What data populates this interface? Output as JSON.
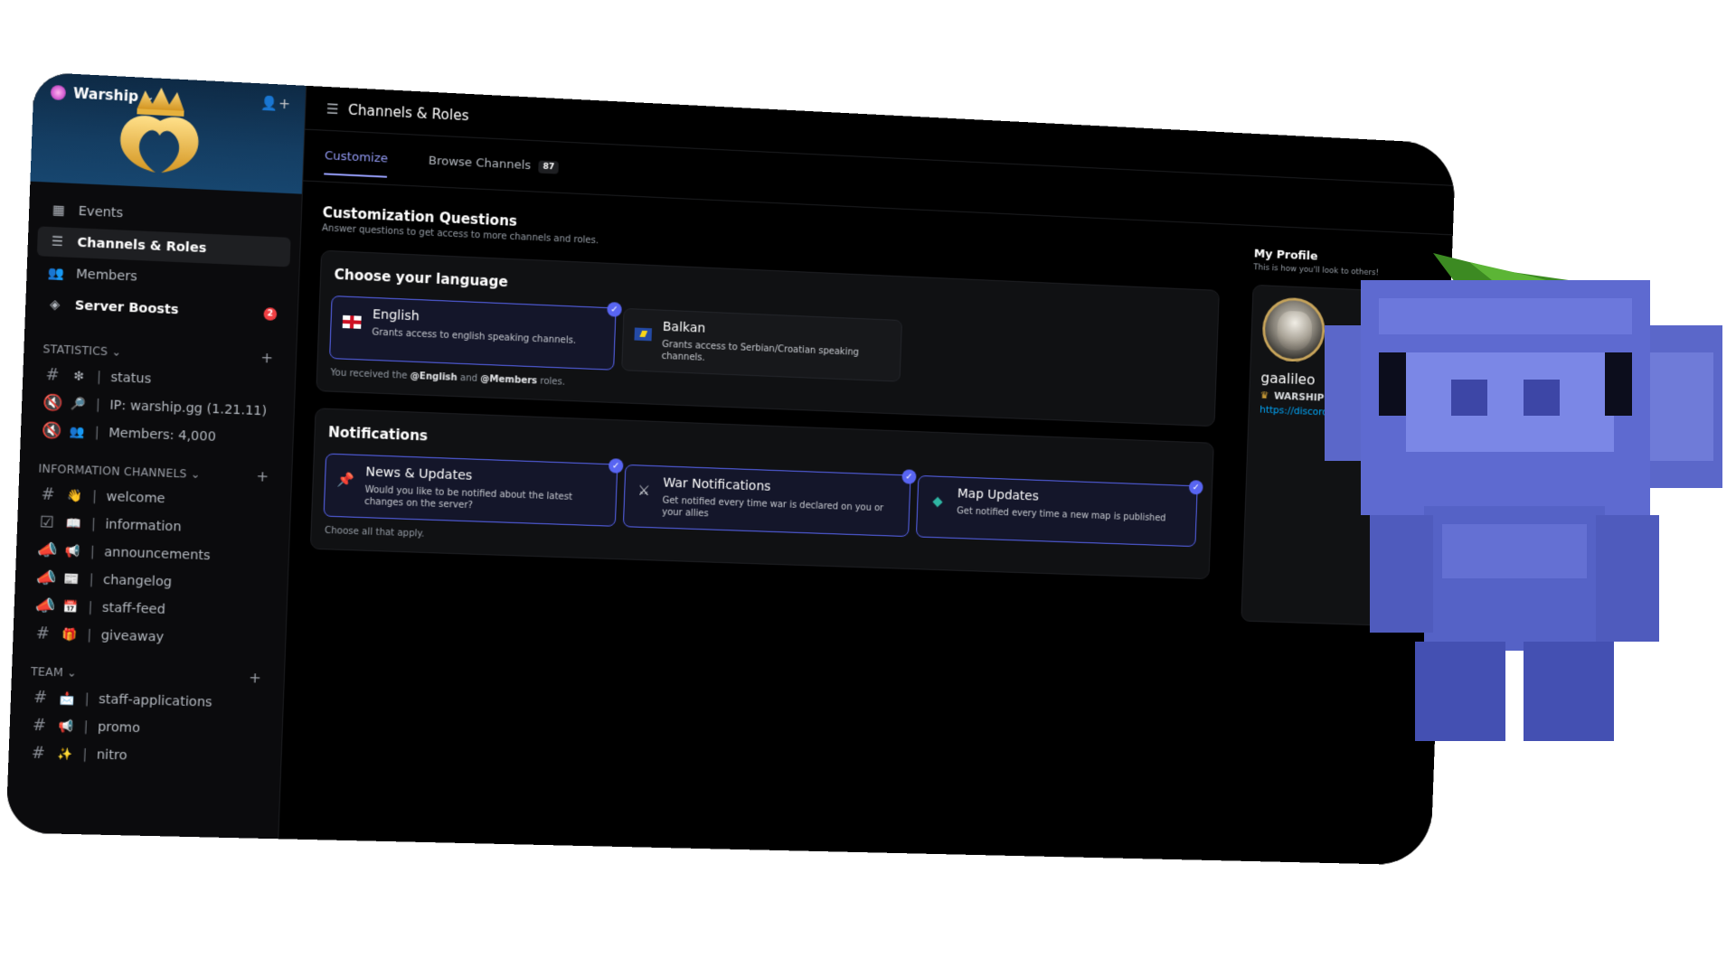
{
  "server": {
    "name": "Warship"
  },
  "nav": [
    {
      "label": "Events",
      "icon": "calendar-icon"
    },
    {
      "label": "Channels & Roles",
      "icon": "channels-roles-icon",
      "active": true
    },
    {
      "label": "Members",
      "icon": "members-icon"
    },
    {
      "label": "Server Boosts",
      "icon": "boost-icon",
      "badge": "2"
    }
  ],
  "categories": [
    {
      "name": "STATISTICS",
      "channels": [
        {
          "icon": "hash-icon",
          "emoji": "❇",
          "name": "status"
        },
        {
          "icon": "speaker-muted-icon",
          "emoji": "🔎",
          "name": "IP: warship.gg (1.21.11)"
        },
        {
          "icon": "speaker-muted-icon",
          "emoji": "👥",
          "name": "Members: 4,000"
        }
      ]
    },
    {
      "name": "INFORMATION CHANNELS",
      "channels": [
        {
          "icon": "hash-icon",
          "emoji": "👋",
          "name": "welcome"
        },
        {
          "icon": "rules-icon",
          "emoji": "📖",
          "name": "information"
        },
        {
          "icon": "megaphone-icon",
          "emoji": "📢",
          "name": "announcements"
        },
        {
          "icon": "megaphone-icon",
          "emoji": "📰",
          "name": "changelog"
        },
        {
          "icon": "megaphone-icon",
          "emoji": "📅",
          "name": "staff-feed"
        },
        {
          "icon": "hash-icon",
          "emoji": "🎁",
          "name": "giveaway"
        }
      ]
    },
    {
      "name": "TEAM",
      "channels": [
        {
          "icon": "hash-icon",
          "emoji": "📩",
          "name": "staff-applications"
        },
        {
          "icon": "hash-icon",
          "emoji": "📢",
          "name": "promo"
        },
        {
          "icon": "hash-icon",
          "emoji": "✨",
          "name": "nitro"
        }
      ]
    }
  ],
  "header": {
    "title": "Channels & Roles"
  },
  "tabs": [
    {
      "label": "Customize",
      "active": true
    },
    {
      "label": "Browse Channels",
      "count": "87"
    }
  ],
  "customization": {
    "title": "Customization Questions",
    "subtitle": "Answer questions to get access to more channels and roles."
  },
  "language": {
    "title": "Choose your language",
    "options": [
      {
        "title": "English",
        "desc": "Grants access to english speaking channels.",
        "selected": true
      },
      {
        "title": "Balkan",
        "desc": "Grants access to Serbian/Croatian speaking channels.",
        "selected": false
      }
    ],
    "note_prefix": "You received the",
    "role1": "@English",
    "note_and": "and",
    "role2": "@Members",
    "note_suffix": "roles."
  },
  "notifications": {
    "title": "Notifications",
    "options": [
      {
        "title": "News & Updates",
        "desc": "Would you like to be notified about the latest changes on the server?",
        "selected": true
      },
      {
        "title": "War Notifications",
        "desc": "Get notified every time war is declared on you or your allies",
        "selected": true
      },
      {
        "title": "Map Updates",
        "desc": "Get notified every time a new map is published",
        "selected": true
      }
    ],
    "note": "Choose all that apply."
  },
  "profile": {
    "title": "My Profile",
    "subtitle": "This is how you'll look to others!",
    "username": "gaalileo",
    "tag": "WARSHIP",
    "link": "https://discord.gg"
  },
  "colors": {
    "accent": "#5865f2",
    "badge": "#f23f43",
    "link": "#00a8fc"
  }
}
